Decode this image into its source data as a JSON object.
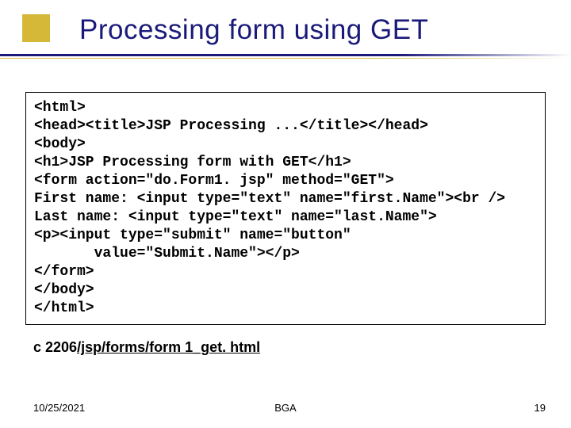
{
  "header": {
    "title": "Processing form using GET"
  },
  "code": {
    "lines": [
      "<html>",
      "<head><title>JSP Processing ...</title></head>",
      "<body>",
      "<h1>JSP Processing form with GET</h1>",
      "<form action=\"do.Form1. jsp\" method=\"GET\">",
      "First name: <input type=\"text\" name=\"first.Name\"><br />",
      "Last name: <input type=\"text\" name=\"last.Name\">",
      "<p><input type=\"submit\" name=\"button\"",
      "       value=\"Submit.Name\"></p>",
      "</form>",
      "</body>",
      "</html>"
    ]
  },
  "filepath": {
    "prefix": "c 2206",
    "linked": "/jsp/forms/form 1_get. html"
  },
  "footer": {
    "date": "10/25/2021",
    "center": "BGA",
    "page": "19"
  }
}
